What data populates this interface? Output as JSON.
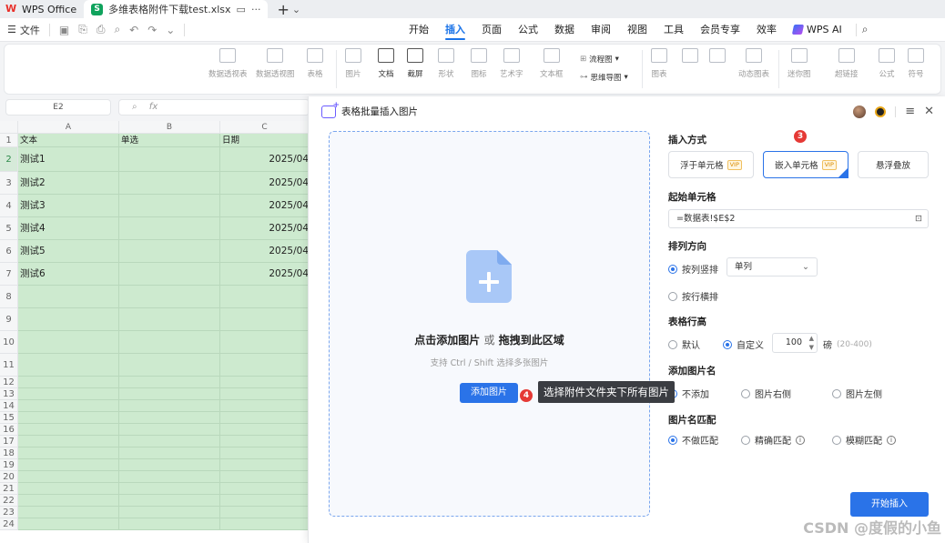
{
  "titlebar": {
    "app_tab": "WPS Office",
    "file_tab": "多维表格附件下载test.xlsx"
  },
  "menubar": {
    "file_menu": "文件",
    "tabs": [
      "开始",
      "插入",
      "页面",
      "公式",
      "数据",
      "审阅",
      "视图",
      "工具",
      "会员专享",
      "效率"
    ],
    "active_tab": "插入",
    "ai_label": "WPS AI"
  },
  "ribbon": {
    "items": [
      "数据透视表",
      "数据透视图",
      "表格",
      "图片",
      "文档",
      "截屏",
      "形状",
      "图标",
      "艺术字",
      "文本框",
      "流程图",
      "思维导图",
      "图表",
      "动态图表",
      "迷你图",
      "超链接",
      "公式",
      "符号"
    ]
  },
  "formula_bar": {
    "cell_ref": "E2",
    "fx": "fx"
  },
  "sheet": {
    "columns": [
      "A",
      "B",
      "C"
    ],
    "rows": [
      "1",
      "2",
      "3",
      "4",
      "5",
      "6",
      "7",
      "8",
      "9",
      "10",
      "11",
      "12",
      "13",
      "14",
      "15",
      "16",
      "17",
      "18",
      "19",
      "20",
      "21",
      "22",
      "23",
      "24"
    ],
    "header_row": [
      "文本",
      "单选",
      "日期"
    ],
    "data": [
      [
        "测试1",
        "",
        "2025/04"
      ],
      [
        "测试2",
        "",
        "2025/04"
      ],
      [
        "测试3",
        "",
        "2025/04"
      ],
      [
        "测试4",
        "",
        "2025/04"
      ],
      [
        "测试5",
        "",
        "2025/04"
      ],
      [
        "测试6",
        "",
        "2025/04"
      ]
    ]
  },
  "dialog": {
    "title": "表格批量插入图片",
    "drop_main_1": "点击添加图片",
    "drop_or": "或",
    "drop_main_2": "拖拽到此区域",
    "drop_sub": "支持 Ctrl / Shift 选择多张图片",
    "add_button": "添加图片",
    "badge_3": "3",
    "badge_4": "4",
    "tooltip": "选择附件文件夹下所有图片",
    "insert_mode_title": "插入方式",
    "insert_modes": [
      "浮于单元格",
      "嵌入单元格",
      "悬浮叠放"
    ],
    "vip": "VIP",
    "start_cell_title": "起始单元格",
    "start_cell_value": "=数据表!$E$2",
    "direction_title": "排列方向",
    "direction_vertical": "按列竖排",
    "direction_select": "单列",
    "direction_horizontal": "按行横排",
    "row_height_title": "表格行高",
    "row_height_default": "默认",
    "row_height_custom": "自定义",
    "row_height_value": "100",
    "row_height_unit": "磅",
    "row_height_range": "(20-400)",
    "name_title": "添加图片名",
    "name_options": [
      "不添加",
      "图片右侧",
      "图片左侧"
    ],
    "match_title": "图片名匹配",
    "match_options": [
      "不做匹配",
      "精确匹配",
      "模糊匹配"
    ],
    "info_symbol": "i",
    "start_button": "开始插入"
  },
  "watermark": "CSDN @度假的小鱼"
}
